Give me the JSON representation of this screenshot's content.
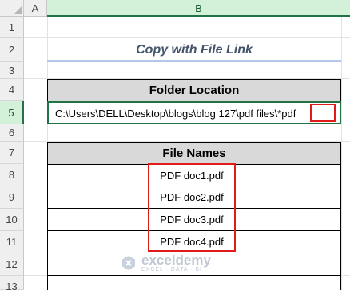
{
  "columns": {
    "a": "A",
    "b": "B"
  },
  "rows": [
    "1",
    "2",
    "3",
    "4",
    "5",
    "6",
    "7",
    "8",
    "9",
    "10",
    "11",
    "12",
    "13"
  ],
  "title": "Copy with File Link",
  "folder_header": "Folder Location",
  "folder_path": "C:\\Users\\DELL\\Desktop\\blogs\\blog 127\\pdf files\\",
  "wildcard": "*pdf",
  "files_header": "File Names",
  "files": [
    "PDF doc1.pdf",
    "PDF doc2.pdf",
    "PDF doc3.pdf",
    "PDF doc4.pdf"
  ],
  "watermark": {
    "name": "exceldemy",
    "tagline": "EXCEL · DATA · BI"
  },
  "colors": {
    "accent": "#217346",
    "highlight": "#e01b1b",
    "title": "#44546a"
  }
}
